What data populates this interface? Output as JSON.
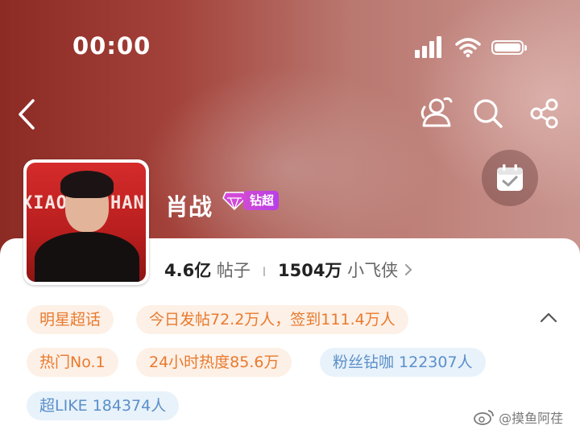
{
  "status_bar": {
    "time": "00:00"
  },
  "nav": {
    "back_icon": "back-arrow-icon",
    "icons": [
      "group-people-icon",
      "search-icon",
      "share-icon"
    ],
    "checkin_icon": "calendar-check-icon"
  },
  "profile": {
    "avatar_text_left": "XIAO",
    "avatar_text_right": "HAN",
    "name": "肖战",
    "badge_label": "钻超",
    "stats": {
      "posts_value": "4.6亿",
      "posts_label": "帖子",
      "separator": "I",
      "fans_value": "1504万",
      "fans_label": "小飞侠"
    }
  },
  "tags": [
    {
      "label": "明星超话",
      "style": "orange"
    },
    {
      "label": "今日发帖72.2万人，签到111.4万人",
      "style": "orange"
    },
    {
      "label": "热门No.1",
      "style": "orange"
    },
    {
      "label": "24小时热度85.6万",
      "style": "orange"
    },
    {
      "label": "粉丝钻咖 122307人",
      "style": "blue"
    },
    {
      "label": "超LIKE 184374人",
      "style": "blue"
    }
  ],
  "watermark": "@摸鱼阿荏",
  "colors": {
    "tag_orange_bg": "#fdf0e6",
    "tag_orange_text": "#e87a2e",
    "tag_blue_bg": "#e8f2fb",
    "tag_blue_text": "#5b8fc9",
    "badge_purple": "#c044e0"
  }
}
